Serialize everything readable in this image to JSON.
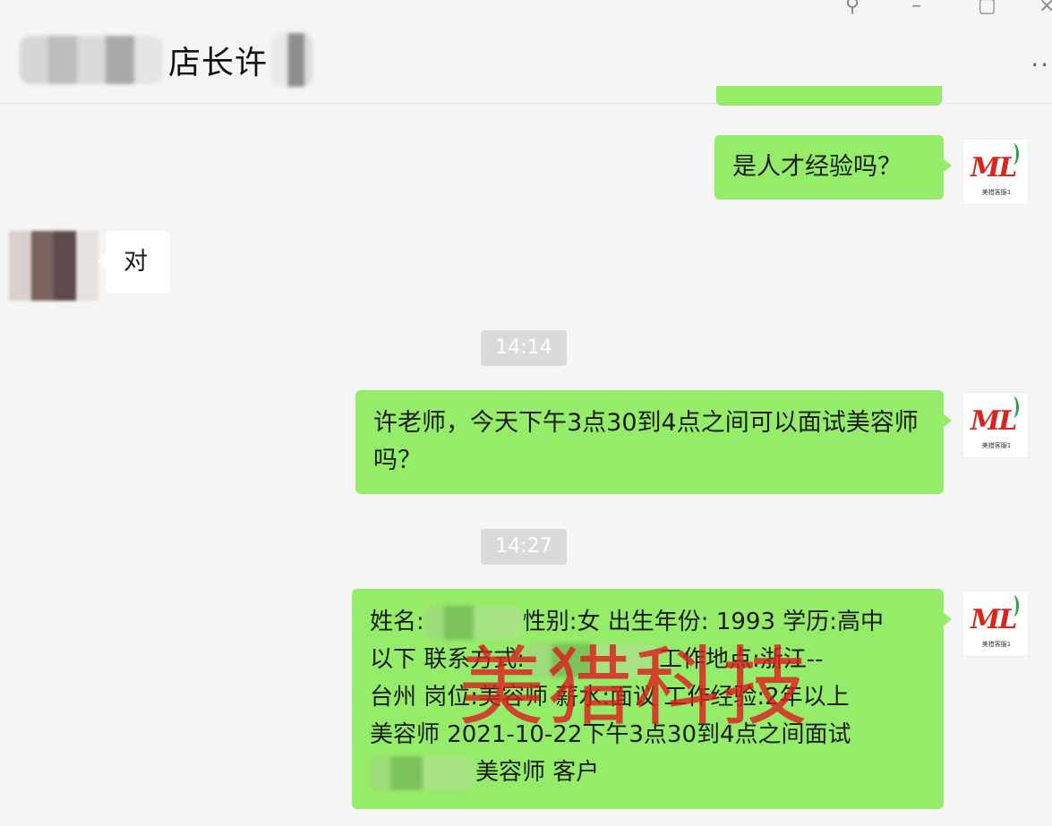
{
  "header": {
    "title": "店长许",
    "window_controls": {
      "pin": "⚲",
      "minimize": "–",
      "maximize": "▢",
      "close": "×"
    },
    "more": "··"
  },
  "messages": [
    {
      "sender": "me",
      "text": "是人才经验吗？"
    },
    {
      "sender": "other",
      "text": "对"
    },
    {
      "time": "14:14"
    },
    {
      "sender": "me",
      "text": "许老师，今天下午3点30到4点之间可以面试美容师吗？"
    },
    {
      "time": "14:27"
    },
    {
      "sender": "me",
      "text_line1a": "姓名:",
      "text_line1b": "性别:女 出生年份: 1993 学历:高中",
      "text_line2": "以下 联系方式:",
      "text_line2b": "工作地点:浙江--",
      "text_line3": "台州 岗位:美容师 薪水:面议 工作经验:2年以上",
      "text_line4": "美容师 2021-10-22下午3点30到4点之间面试",
      "text_line5": "美容师 客户"
    }
  ],
  "avatar_logo": {
    "mark": "ML",
    "sub": "美猎客服1"
  },
  "watermark": "美猎科技"
}
